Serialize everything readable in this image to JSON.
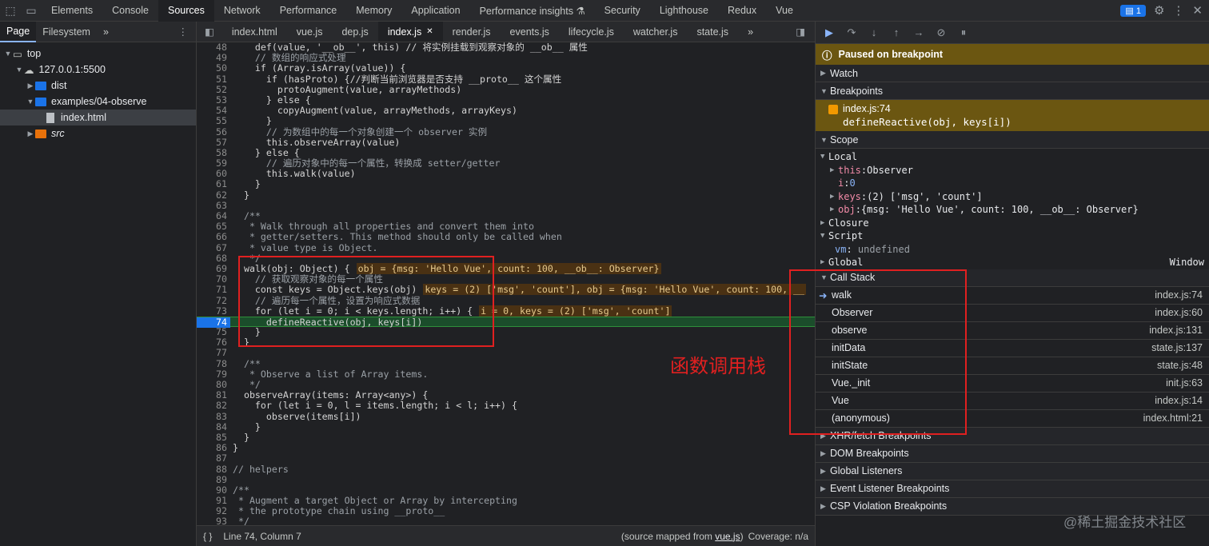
{
  "top_tabs": [
    "Elements",
    "Console",
    "Sources",
    "Network",
    "Performance",
    "Memory",
    "Application",
    "Performance insights ⚗",
    "Security",
    "Lighthouse",
    "Redux",
    "Vue"
  ],
  "issues_badge": "1",
  "left": {
    "subtabs": [
      "Page",
      "Filesystem",
      "»"
    ],
    "tree": [
      {
        "label": "top",
        "indent": 0,
        "arrow": "▼",
        "icon": "frame"
      },
      {
        "label": "127.0.0.1:5500",
        "indent": 1,
        "arrow": "▼",
        "icon": "cloud"
      },
      {
        "label": "dist",
        "indent": 2,
        "arrow": "▶",
        "icon": "folder"
      },
      {
        "label": "examples/04-observe",
        "indent": 2,
        "arrow": "▼",
        "icon": "folder"
      },
      {
        "label": "index.html",
        "indent": 3,
        "arrow": "",
        "icon": "file",
        "selected": true
      },
      {
        "label": "src",
        "indent": 2,
        "arrow": "▶",
        "icon": "folder-orange",
        "italic": true
      }
    ]
  },
  "file_tabs": [
    "index.html",
    "vue.js",
    "dep.js",
    "index.js",
    "render.js",
    "events.js",
    "lifecycle.js",
    "watcher.js",
    "state.js"
  ],
  "active_file": "index.js",
  "code": [
    {
      "n": "48",
      "t": "    def(value, '__ob__', this) // 将实例挂载到观察对象的 __ob__ 属性"
    },
    {
      "n": "49",
      "t": "    // 数组的响应式处理",
      "c": 1
    },
    {
      "n": "50",
      "t": "    if (Array.isArray(value)) {"
    },
    {
      "n": "51",
      "t": "      if (hasProto) {//判断当前浏览器是否支持 __proto__ 这个属性"
    },
    {
      "n": "52",
      "t": "        protoAugment(value, arrayMethods)"
    },
    {
      "n": "53",
      "t": "      } else {"
    },
    {
      "n": "54",
      "t": "        copyAugment(value, arrayMethods, arrayKeys)"
    },
    {
      "n": "55",
      "t": "      }"
    },
    {
      "n": "56",
      "t": "      // 为数组中的每一个对象创建一个 observer 实例",
      "c": 1
    },
    {
      "n": "57",
      "t": "      this.observeArray(value)"
    },
    {
      "n": "58",
      "t": "    } else {"
    },
    {
      "n": "59",
      "t": "      // 遍历对象中的每一个属性，转换成 setter/getter",
      "c": 1
    },
    {
      "n": "60",
      "t": "      this.walk(value)"
    },
    {
      "n": "61",
      "t": "    }"
    },
    {
      "n": "62",
      "t": "  }"
    },
    {
      "n": "63",
      "t": ""
    },
    {
      "n": "64",
      "t": "  /**",
      "c": 1
    },
    {
      "n": "65",
      "t": "   * Walk through all properties and convert them into",
      "c": 1
    },
    {
      "n": "66",
      "t": "   * getter/setters. This method should only be called when",
      "c": 1
    },
    {
      "n": "67",
      "t": "   * value type is Object.",
      "c": 1
    },
    {
      "n": "68",
      "t": "   */",
      "c": 1
    },
    {
      "n": "69",
      "t": "  walk(obj: Object) {",
      "inl": "obj = {msg: 'Hello Vue', count: 100, __ob__: Observer}"
    },
    {
      "n": "70",
      "t": "    // 获取观察对象的每一个属性",
      "c": 1
    },
    {
      "n": "71",
      "t": "    const keys = Object.keys(obj)",
      "inl": "keys = (2) ['msg', 'count'], obj = {msg: 'Hello Vue', count: 100, __"
    },
    {
      "n": "72",
      "t": "    // 遍历每一个属性，设置为响应式数据",
      "c": 1
    },
    {
      "n": "73",
      "t": "    for (let i = 0; i < keys.length; i++) {",
      "inl": "i = 0, keys = (2) ['msg', 'count']"
    },
    {
      "n": "74",
      "t": "      defineReactive(obj, keys[i])",
      "cur": 1
    },
    {
      "n": "75",
      "t": "    }"
    },
    {
      "n": "76",
      "t": "  }"
    },
    {
      "n": "77",
      "t": ""
    },
    {
      "n": "78",
      "t": "  /**",
      "c": 1
    },
    {
      "n": "79",
      "t": "   * Observe a list of Array items.",
      "c": 1
    },
    {
      "n": "80",
      "t": "   */",
      "c": 1
    },
    {
      "n": "81",
      "t": "  observeArray(items: Array<any>) {"
    },
    {
      "n": "82",
      "t": "    for (let i = 0, l = items.length; i < l; i++) {"
    },
    {
      "n": "83",
      "t": "      observe(items[i])"
    },
    {
      "n": "84",
      "t": "    }"
    },
    {
      "n": "85",
      "t": "  }"
    },
    {
      "n": "86",
      "t": "}"
    },
    {
      "n": "87",
      "t": ""
    },
    {
      "n": "88",
      "t": "// helpers",
      "c": 1
    },
    {
      "n": "89",
      "t": ""
    },
    {
      "n": "90",
      "t": "/**",
      "c": 1
    },
    {
      "n": "91",
      "t": " * Augment a target Object or Array by intercepting",
      "c": 1
    },
    {
      "n": "92",
      "t": " * the prototype chain using __proto__",
      "c": 1
    },
    {
      "n": "93",
      "t": " */",
      "c": 1
    }
  ],
  "status": {
    "braces": "{ }",
    "position": "Line 74, Column 7",
    "source_prefix": "(source mapped from ",
    "source_link": "vue.js",
    "source_suffix": ")",
    "coverage": "Coverage: n/a"
  },
  "right": {
    "paused": "Paused on breakpoint",
    "watch": "Watch",
    "breakpoints": "Breakpoints",
    "bp_file": "index.js:74",
    "bp_code": "defineReactive(obj, keys[i])",
    "scope": "Scope",
    "local": "Local",
    "scope_rows": [
      {
        "arrow": "▶",
        "k": "this",
        "v": "Observer"
      },
      {
        "arrow": "",
        "k": "i",
        "v": "0",
        "num": true
      },
      {
        "arrow": "▶",
        "k": "keys",
        "v": "(2) ['msg', 'count']"
      },
      {
        "arrow": "▶",
        "k": "obj",
        "v": "{msg: 'Hello Vue', count: 100, __ob__: Observer}"
      }
    ],
    "closure": "Closure",
    "script": "Script",
    "vm_key": "vm",
    "vm_val": "undefined",
    "global": "Global",
    "global_val": "Window",
    "callstack": "Call Stack",
    "frames": [
      {
        "fn": "walk",
        "loc": "index.js:74",
        "cur": true
      },
      {
        "fn": "Observer",
        "loc": "index.js:60"
      },
      {
        "fn": "observe",
        "loc": "index.js:131"
      },
      {
        "fn": "initData",
        "loc": "state.js:137"
      },
      {
        "fn": "initState",
        "loc": "state.js:48"
      },
      {
        "fn": "Vue._init",
        "loc": "init.js:63"
      },
      {
        "fn": "Vue",
        "loc": "index.js:14"
      },
      {
        "fn": "(anonymous)",
        "loc": "index.html:21"
      }
    ],
    "sections": [
      "XHR/fetch Breakpoints",
      "DOM Breakpoints",
      "Global Listeners",
      "Event Listener Breakpoints",
      "CSP Violation Breakpoints"
    ]
  },
  "annotation": "函数调用栈",
  "watermark": "@稀土掘金技术社区",
  "colors": {
    "accent": "#1a73e8",
    "annotation_red": "#e02020",
    "paused_bg": "#6b5611"
  }
}
